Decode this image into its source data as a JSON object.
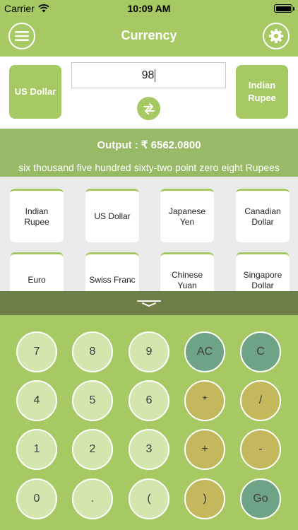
{
  "status_bar": {
    "carrier": "Carrier",
    "time": "10:09 AM"
  },
  "nav": {
    "title": "Currency",
    "menu_icon": "hamburger-menu-icon",
    "settings_icon": "gear-icon"
  },
  "converter": {
    "from_currency": "US Dollar",
    "to_currency": "Indian Rupee",
    "amount": "98",
    "swap_icon": "swap-arrows-icon"
  },
  "output": {
    "value": "Output : ₹ 6562.0800",
    "words": "six thousand five hundred sixty-two point zero eight Rupees"
  },
  "currencies": [
    "Indian Rupee",
    "US Dollar",
    "Japanese Yen",
    "Canadian Dollar",
    "Euro",
    "Swiss Franc",
    "Chinese Yuan",
    "Singapore Dollar"
  ],
  "keypad": {
    "row1": [
      "7",
      "8",
      "9",
      "AC",
      "C"
    ],
    "row2": [
      "4",
      "5",
      "6",
      "*",
      "/"
    ],
    "row3": [
      "1",
      "2",
      "3",
      "+",
      "-"
    ],
    "row4": [
      "0",
      ".",
      "(",
      ")",
      "Go"
    ]
  },
  "colors": {
    "primary_green": "#a6c964",
    "output_green": "#98b966",
    "handle_dark_green": "#6d7f47",
    "number_key": "#d3e6ae",
    "clear_key": "#6fa385",
    "operator_key": "#c3b95c"
  }
}
